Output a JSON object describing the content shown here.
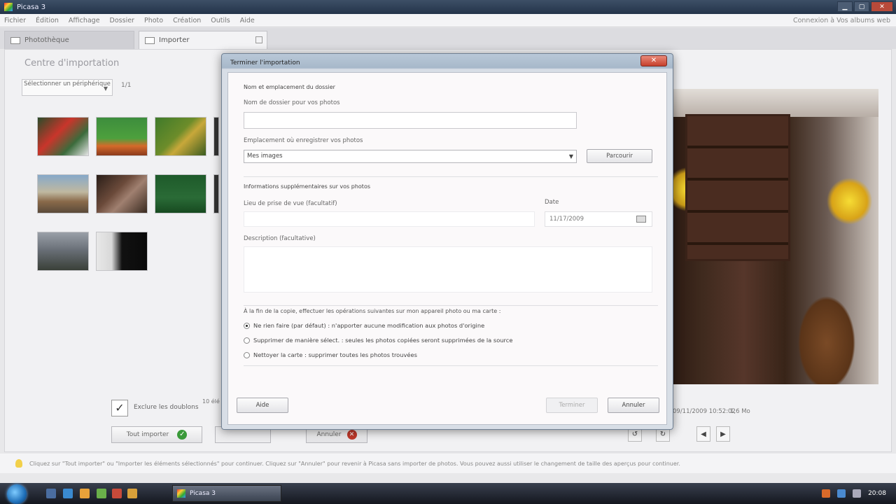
{
  "window": {
    "title": "Picasa 3"
  },
  "window_controls": {
    "minimize": "▁",
    "maximize": "▢",
    "close": "✕"
  },
  "menu": {
    "items": [
      "Fichier",
      "Édition",
      "Affichage",
      "Dossier",
      "Photo",
      "Création",
      "Outils",
      "Aide"
    ],
    "account": "Connexion à Vos albums web"
  },
  "tabs": {
    "library": "Photothèque",
    "import": "Importer"
  },
  "main": {
    "heading": "Centre d'importation",
    "source_select": "Sélectionner un périphérique",
    "count": "1/1",
    "exclude_duplicates": "Exclure les doublons",
    "side_note": "10 élé",
    "btn_import_all": "Tout importer",
    "btn_import_selected": "",
    "btn_cancel": "Annuler",
    "photo_date": "09/11/2009 10:52:02",
    "photo_size": "1,6 Mo"
  },
  "info_text": "Cliquez sur \"Tout importer\" ou \"Importer les éléments sélectionnés\" pour continuer. Cliquez sur \"Annuler\" pour revenir à Picasa sans importer de photos. Vous pouvez aussi utiliser le changement de taille des aperçus pour continuer.",
  "dialog": {
    "title": "Terminer l'importation",
    "close_glyph": "✕",
    "section_name_location": "Nom et emplacement du dossier",
    "label_folder_name": "Nom de dossier pour vos photos",
    "folder_name_value": "",
    "label_location": "Emplacement où enregistrer vos photos",
    "location_value": "Mes images",
    "btn_browse": "Parcourir",
    "section_extra": "Informations supplémentaires sur vos photos",
    "label_place": "Lieu de prise de vue (facultatif)",
    "place_value": "",
    "label_date": "Date",
    "date_value": "11/17/2009",
    "label_description": "Description (facultative)",
    "description_value": "",
    "section_after": "À la fin de la copie, effectuer les opérations suivantes sur mon appareil photo ou ma carte :",
    "radio_options": [
      "Ne rien faire (par défaut) : n'apporter aucune modification aux photos d'origine",
      "Supprimer de manière sélect. : seules les photos copiées seront supprimées de la source",
      "Nettoyer la carte : supprimer toutes les photos trouvées"
    ],
    "btn_help": "Aide",
    "btn_finish": "Terminer",
    "btn_cancel": "Annuler"
  },
  "taskbar": {
    "app": "Picasa 3",
    "clock": "20:08"
  }
}
